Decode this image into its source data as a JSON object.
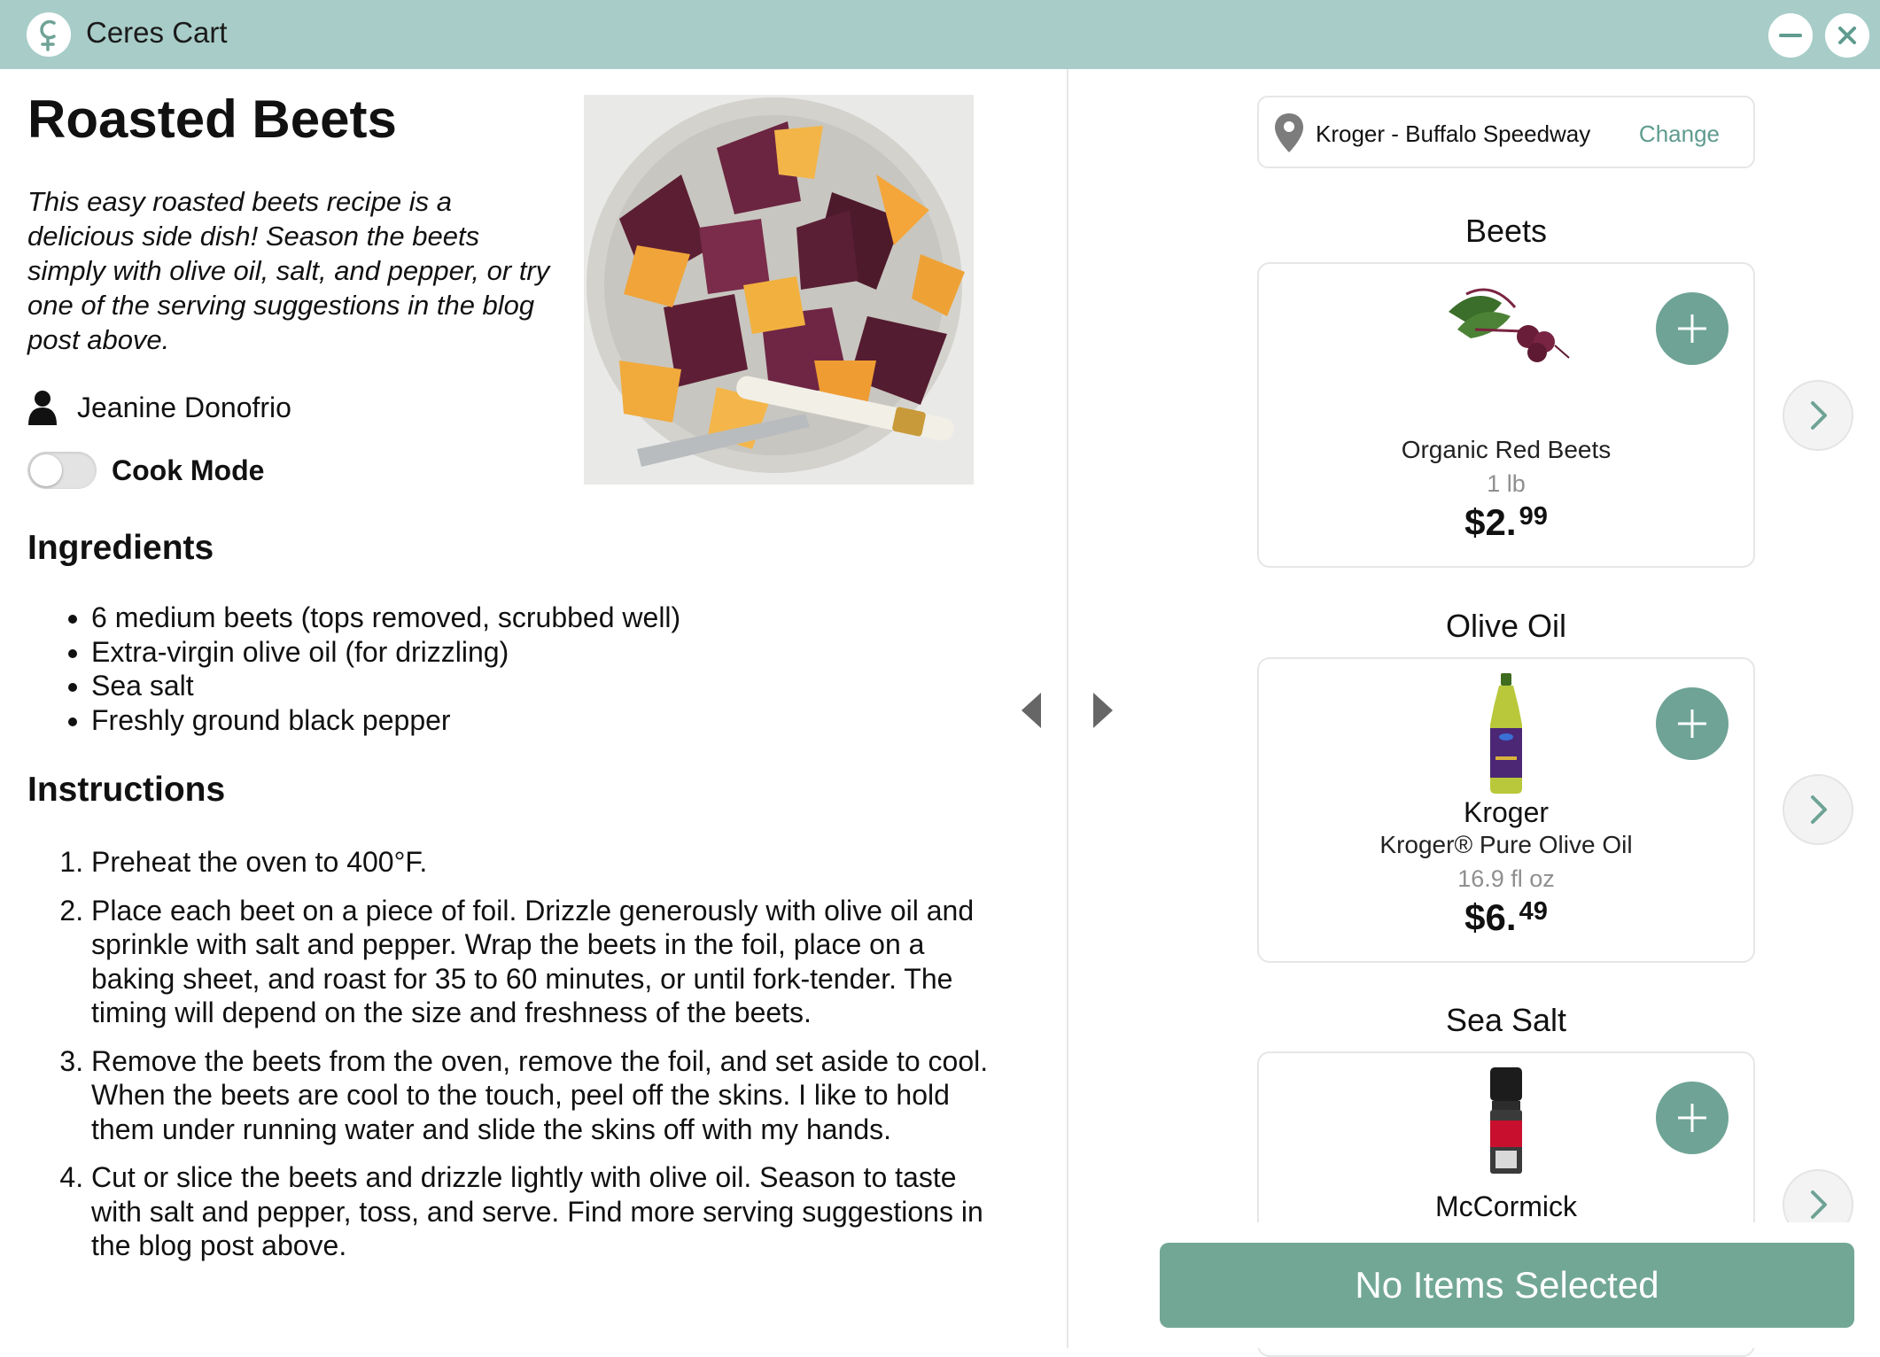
{
  "app": {
    "title": "Ceres Cart"
  },
  "recipe": {
    "title": "Roasted Beets",
    "description": "This easy roasted beets recipe is a delicious side dish! Season the beets simply with olive oil, salt, and pepper, or try one of the serving suggestions in the blog post above.",
    "author": "Jeanine Donofrio",
    "cook_mode_label": "Cook Mode",
    "cook_mode_on": false,
    "ingredients_heading": "Ingredients",
    "ingredients": [
      "6 medium beets (tops removed, scrubbed well)",
      "Extra-virgin olive oil (for drizzling)",
      "Sea salt",
      "Freshly ground black pepper"
    ],
    "instructions_heading": "Instructions",
    "instructions": [
      "Preheat the oven to 400°F.",
      "Place each beet on a piece of foil. Drizzle generously with olive oil and sprinkle with salt and pepper. Wrap the beets in the foil, place on a baking sheet, and roast for 35 to 60 minutes, or until fork-tender. The timing will depend on the size and freshness of the beets.",
      "Remove the beets from the oven, remove the foil, and set aside to cool. When the beets are cool to the touch, peel off the skins. I like to hold them under running water and slide the skins off with my hands.",
      "Cut or slice the beets and drizzle lightly with olive oil. Season to taste with salt and pepper, toss, and serve. Find more serving suggestions in the blog post above."
    ]
  },
  "store": {
    "name": "Kroger - Buffalo Speedway",
    "change_label": "Change"
  },
  "products": [
    {
      "category": "Beets",
      "brand": "",
      "name": "Organic Red Beets",
      "size": "1 lb",
      "price_dollars": "$2.",
      "price_cents": "99"
    },
    {
      "category": "Olive Oil",
      "brand": "Kroger",
      "name": "Kroger® Pure Olive Oil",
      "size": "16.9 fl oz",
      "price_dollars": "$6.",
      "price_cents": "49"
    },
    {
      "category": "Sea Salt",
      "brand": "McCormick"
    }
  ],
  "checkout": {
    "label": "No Items Selected"
  },
  "colors": {
    "titlebar": "#a8cdc8",
    "accent": "#6ea395",
    "checkout": "#72a796",
    "link": "#5f9b8f"
  },
  "icons": [
    "ceres-logo-icon",
    "minimize-icon",
    "close-icon",
    "user-icon",
    "location-pin-icon",
    "plus-icon",
    "chevron-right-icon",
    "triangle-left-icon",
    "triangle-right-icon"
  ]
}
